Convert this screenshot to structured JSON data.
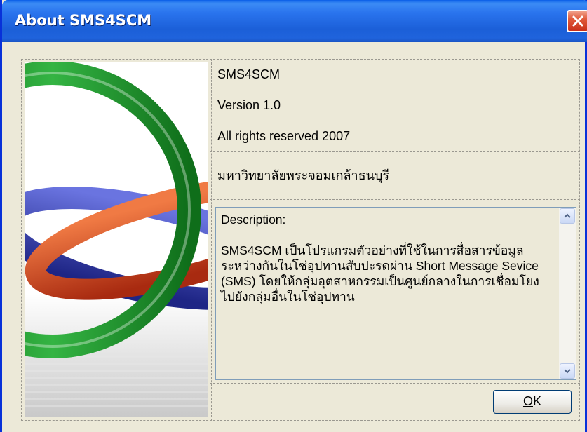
{
  "window": {
    "title": "About SMS4SCM"
  },
  "info": {
    "product": "SMS4SCM",
    "version": "Version 1.0",
    "copyright": "All rights reserved 2007",
    "university": "มหาวิทยาลัยพระจอมเกล้าธนบุรี"
  },
  "description": {
    "heading": "Description:",
    "body": "SMS4SCM เป็นโปรแกรมตัวอย่างที่ใช้ในการสื่อสารข้อมูลระหว่างกันในโซ่อุปทานสับปะรดผ่าน Short Message Sevice (SMS) โดยให้กลุ่มอุตสาหกรรมเป็นศูนย์กลางในการเชื่อมโยงไปยังกลุ่มอื่นในโซ่อุปทาน"
  },
  "buttons": {
    "ok_mnemonic": "O",
    "ok_rest": "K"
  },
  "colors": {
    "title_bar": "#1f63dc",
    "dialog_bg": "#ece9d8",
    "ring_green": "#1f9a2c",
    "ring_red": "#d8441c",
    "ring_blue": "#3a44b8"
  }
}
